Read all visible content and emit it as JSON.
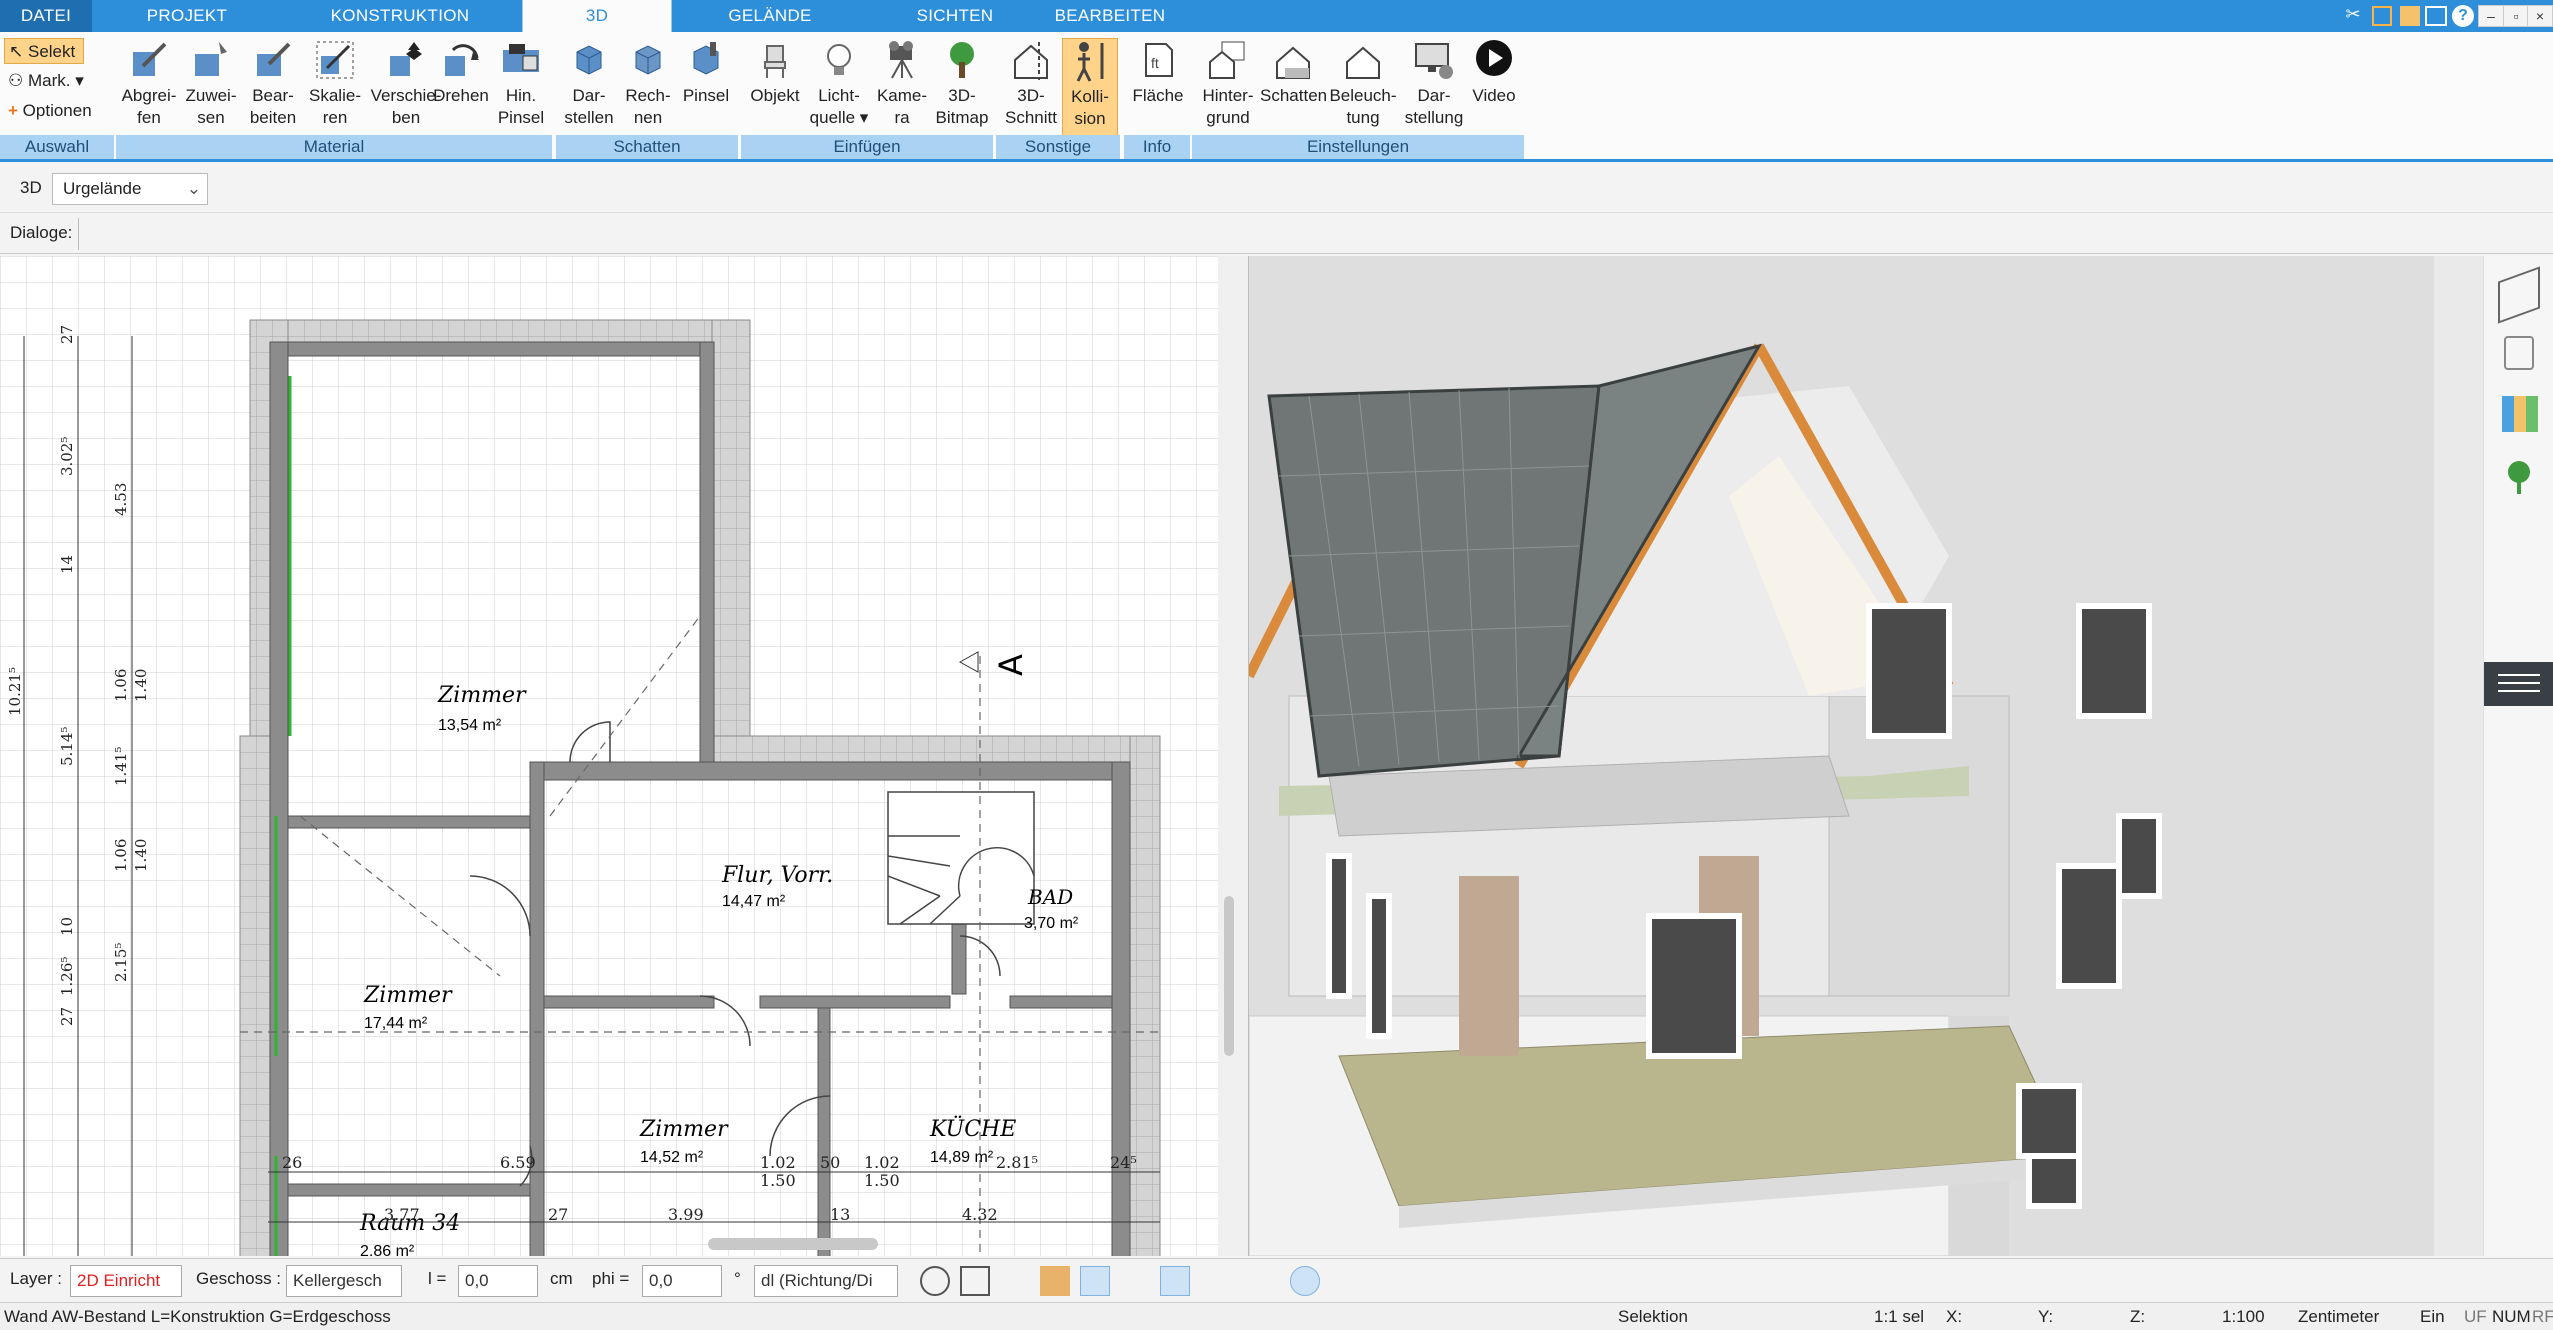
{
  "tabs": [
    "DATEI",
    "PROJEKT",
    "KONSTRUKTION",
    "3D",
    "GELÄNDE",
    "SICHTEN",
    "BEARBEITEN"
  ],
  "active_tab": "3D",
  "ribbon": {
    "auswahl": {
      "select": "Selekt",
      "mark": "Mark.",
      "options": "Optionen",
      "group": "Auswahl"
    },
    "material": {
      "group": "Material",
      "buttons": [
        {
          "l1": "Abgrei-",
          "l2": "fen"
        },
        {
          "l1": "Zuwei-",
          "l2": "sen"
        },
        {
          "l1": "Bear-",
          "l2": "beiten"
        },
        {
          "l1": "Skalie-",
          "l2": "ren"
        },
        {
          "l1": "Verschie-",
          "l2": "ben"
        },
        {
          "l1": "Drehen",
          "l2": ""
        },
        {
          "l1": "Hin.",
          "l2": "Pinsel"
        }
      ]
    },
    "schatten": {
      "group": "Schatten",
      "buttons": [
        {
          "l1": "Dar-",
          "l2": "stellen"
        },
        {
          "l1": "Rech-",
          "l2": "nen"
        },
        {
          "l1": "Pinsel",
          "l2": ""
        }
      ]
    },
    "einfuegen": {
      "group": "Einfügen",
      "buttons": [
        {
          "l1": "Objekt",
          "l2": ""
        },
        {
          "l1": "Licht-",
          "l2": "quelle"
        },
        {
          "l1": "Kame-",
          "l2": "ra"
        },
        {
          "l1": "3D-",
          "l2": "Bitmap"
        }
      ]
    },
    "sonstige": {
      "group": "Sonstige",
      "buttons": [
        {
          "l1": "3D-",
          "l2": "Schnitt"
        },
        {
          "l1": "Kolli-",
          "l2": "sion"
        }
      ]
    },
    "info": {
      "group": "Info",
      "buttons": [
        {
          "l1": "Fläche",
          "l2": ""
        }
      ]
    },
    "einstellungen": {
      "group": "Einstellungen",
      "buttons": [
        {
          "l1": "Hinter-",
          "l2": "grund"
        },
        {
          "l1": "Schatten",
          "l2": ""
        },
        {
          "l1": "Beleuch-",
          "l2": "tung"
        },
        {
          "l1": "Dar-",
          "l2": "stellung"
        },
        {
          "l1": "Video",
          "l2": ""
        }
      ]
    }
  },
  "viewbar": {
    "mode": "3D",
    "terrain": "Urgelände"
  },
  "dialogbar": {
    "label": "Dialoge:"
  },
  "plan": {
    "rooms": [
      {
        "name": "Zimmer",
        "area": "13,54 m²"
      },
      {
        "name": "Flur, Vorr.",
        "area": "14,47 m²"
      },
      {
        "name": "BAD",
        "area": "3,70 m²"
      },
      {
        "name": "Zimmer",
        "area": "17,44 m²"
      },
      {
        "name": "Zimmer",
        "area": "14,52 m²"
      },
      {
        "name": "KÜCHE",
        "area": "14,89 m²"
      },
      {
        "name": "Raum 34",
        "area": "2,86 m²"
      }
    ],
    "section_mark": "A",
    "dims_left": [
      "27",
      "3.02⁵",
      "4.53",
      "14",
      "10.21⁵",
      "5.14⁵",
      "1.06",
      "1.40",
      "1.41⁵",
      "1.06",
      "1.40",
      "10",
      "2.15⁵",
      "1.26⁵",
      "27"
    ],
    "dims_bottom_top": [
      "26",
      "6.59",
      "1.02",
      "1.50",
      "50",
      "1.02",
      "1.50",
      "2.81⁵",
      "24⁵",
      "24⁵"
    ],
    "dims_bottom": [
      "3.77",
      "27",
      "3.99",
      "13",
      "4.32"
    ]
  },
  "toolbar2": {
    "layer_label": "Layer :",
    "layer_value": "2D Einricht",
    "geschoss_label": "Geschoss :",
    "geschoss_value": "Kellergesch",
    "l_label": "l =",
    "l_value": "0,0",
    "l_unit": "cm",
    "phi_label": "phi =",
    "phi_value": "0,0",
    "phi_unit": "°",
    "direction_value": "dl (Richtung/Di"
  },
  "status": {
    "left": "Wand AW-Bestand L=Konstruktion G=Erdgeschoss",
    "mode": "Selektion",
    "sel": "1:1 sel",
    "x": "X:",
    "y": "Y:",
    "z": "Z:",
    "scale": "1:100",
    "unit": "Zentimeter",
    "ein": "Ein",
    "uf": "UF",
    "num": "NUM",
    "rf": "RF"
  },
  "colors": {
    "accent": "#2d8fd9",
    "group_bar": "#aad2f3",
    "selected": "#ffd48a",
    "wall": "#8c8c8c",
    "roof": "#6f7675",
    "timber": "#d98a3a"
  }
}
